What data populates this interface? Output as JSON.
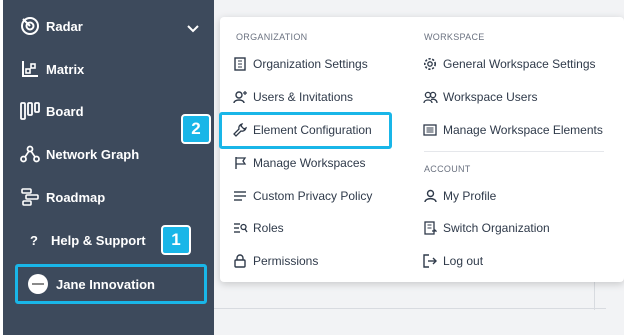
{
  "sidebar": {
    "items": [
      {
        "label": "Radar",
        "icon": "radar-icon"
      },
      {
        "label": "Matrix",
        "icon": "matrix-icon"
      },
      {
        "label": "Board",
        "icon": "board-icon"
      },
      {
        "label": "Network Graph",
        "icon": "network-graph-icon"
      },
      {
        "label": "Roadmap",
        "icon": "roadmap-icon"
      }
    ],
    "help_label": "Help & Support",
    "user_name": "Jane Innovation"
  },
  "badges": {
    "one": "1",
    "two": "2"
  },
  "menu": {
    "organization": {
      "header": "ORGANIZATION",
      "items": [
        {
          "label": "Organization Settings",
          "icon": "building-icon"
        },
        {
          "label": "Users & Invitations",
          "icon": "user-plus-icon"
        },
        {
          "label": "Element Configuration",
          "icon": "wrench-icon"
        },
        {
          "label": "Manage Workspaces",
          "icon": "flag-icon"
        },
        {
          "label": "Custom Privacy Policy",
          "icon": "lines-icon"
        },
        {
          "label": "Roles",
          "icon": "roles-icon"
        },
        {
          "label": "Permissions",
          "icon": "lock-icon"
        }
      ]
    },
    "workspace": {
      "header": "WORKSPACE",
      "items": [
        {
          "label": "General Workspace Settings",
          "icon": "gear-icon"
        },
        {
          "label": "Workspace Users",
          "icon": "users-icon"
        },
        {
          "label": "Manage Workspace Elements",
          "icon": "list-box-icon"
        }
      ]
    },
    "account": {
      "header": "ACCOUNT",
      "items": [
        {
          "label": "My Profile",
          "icon": "user-icon"
        },
        {
          "label": "Switch Organization",
          "icon": "switch-org-icon"
        },
        {
          "label": "Log out",
          "icon": "logout-icon"
        }
      ]
    }
  },
  "colors": {
    "sidebar_bg": "#3d4a5c",
    "accent": "#19b6e8",
    "menu_text": "#2f3a4a"
  }
}
